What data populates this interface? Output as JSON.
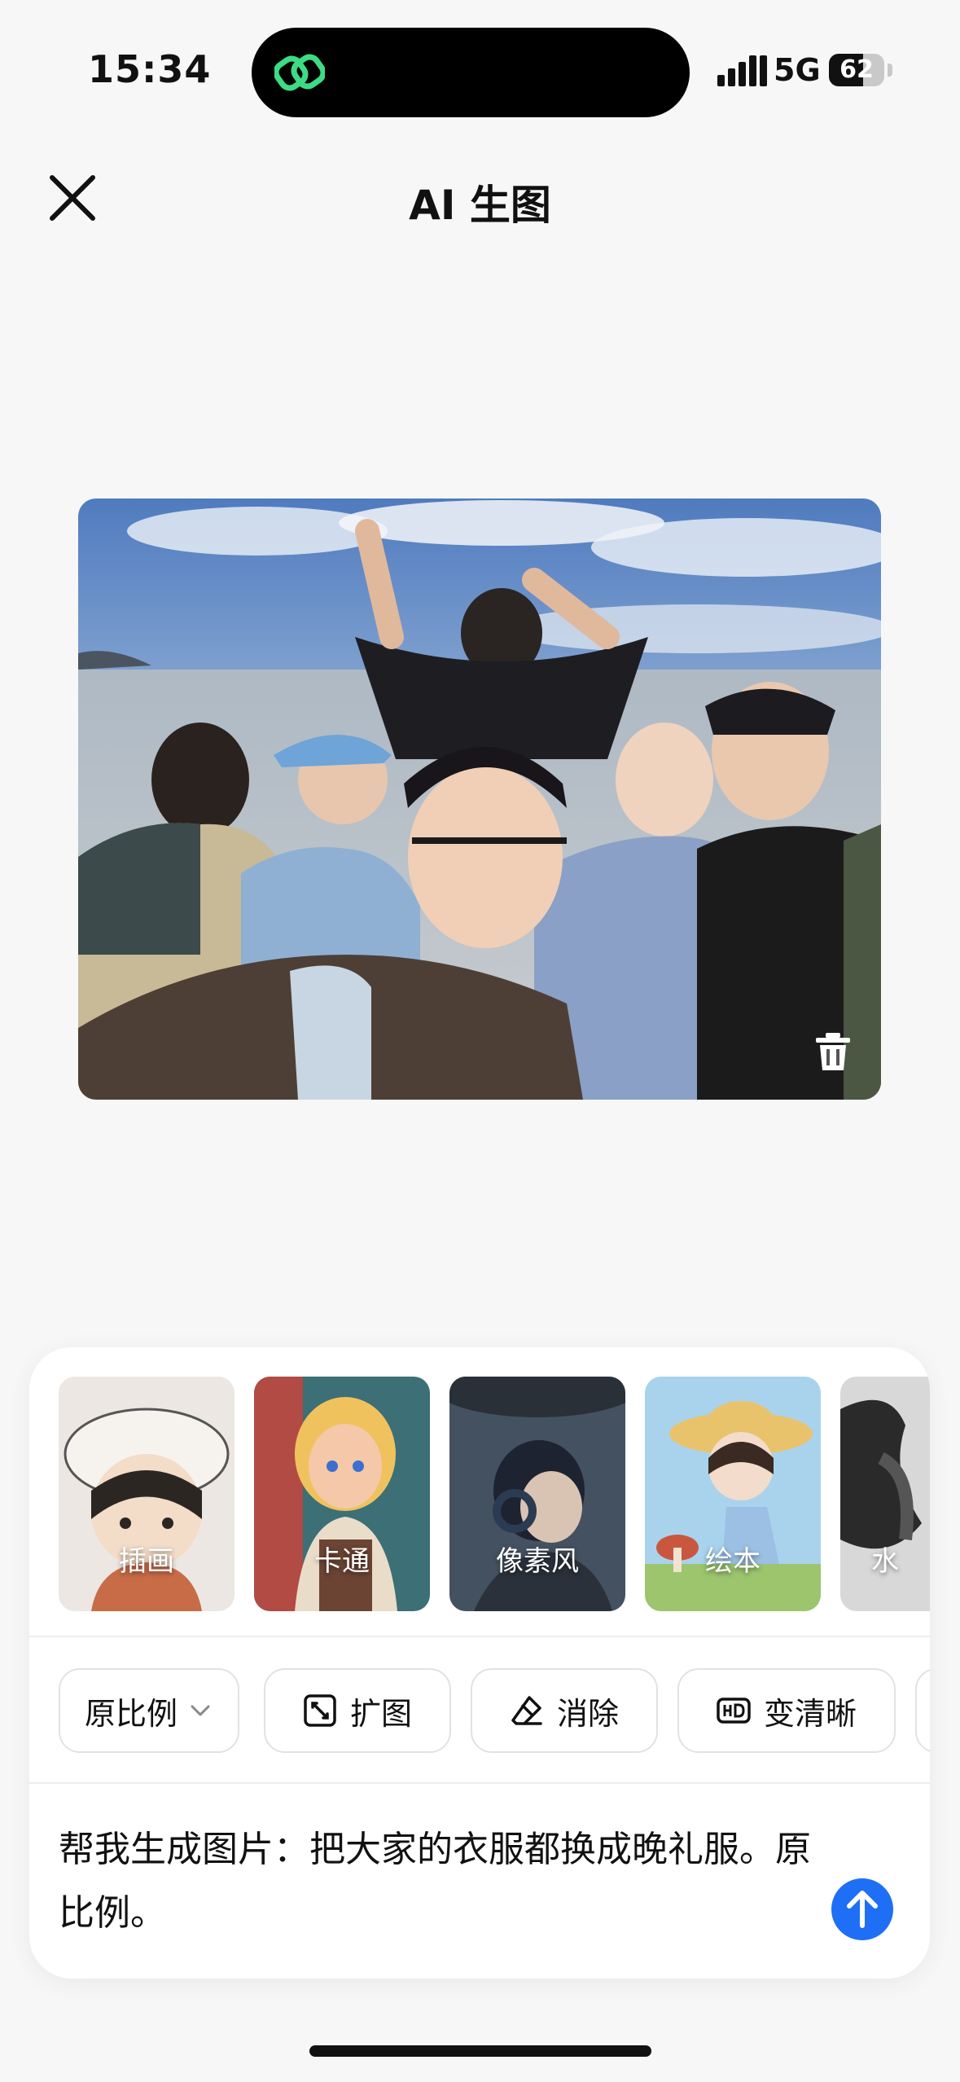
{
  "status_bar": {
    "time": "15:34",
    "network": "5G",
    "battery": "62",
    "battery_level": 0.62
  },
  "header": {
    "title": "AI 生图",
    "close_icon": "close-icon"
  },
  "photo": {
    "delete_icon": "trash-icon"
  },
  "styles": [
    {
      "label": "插画",
      "icon": "illustration-thumbnail"
    },
    {
      "label": "卡通",
      "icon": "cartoon-thumbnail"
    },
    {
      "label": "像素风",
      "icon": "pixel-thumbnail"
    },
    {
      "label": "绘本",
      "icon": "picture-book-thumbnail"
    },
    {
      "label": "水",
      "icon": "ink-thumbnail"
    }
  ],
  "tools": [
    {
      "label": "原比例",
      "icon": "chevron-down-icon"
    },
    {
      "label": "扩图",
      "icon": "expand-icon"
    },
    {
      "label": "消除",
      "icon": "eraser-icon"
    },
    {
      "label": "变清晰",
      "icon": "hd-icon"
    }
  ],
  "prompt": {
    "text": "帮我生成图片：把大家的衣服都换成晚礼服。原比例。"
  },
  "colors": {
    "accent": "#1e6ff5",
    "island_logo": "#3ddc84"
  }
}
